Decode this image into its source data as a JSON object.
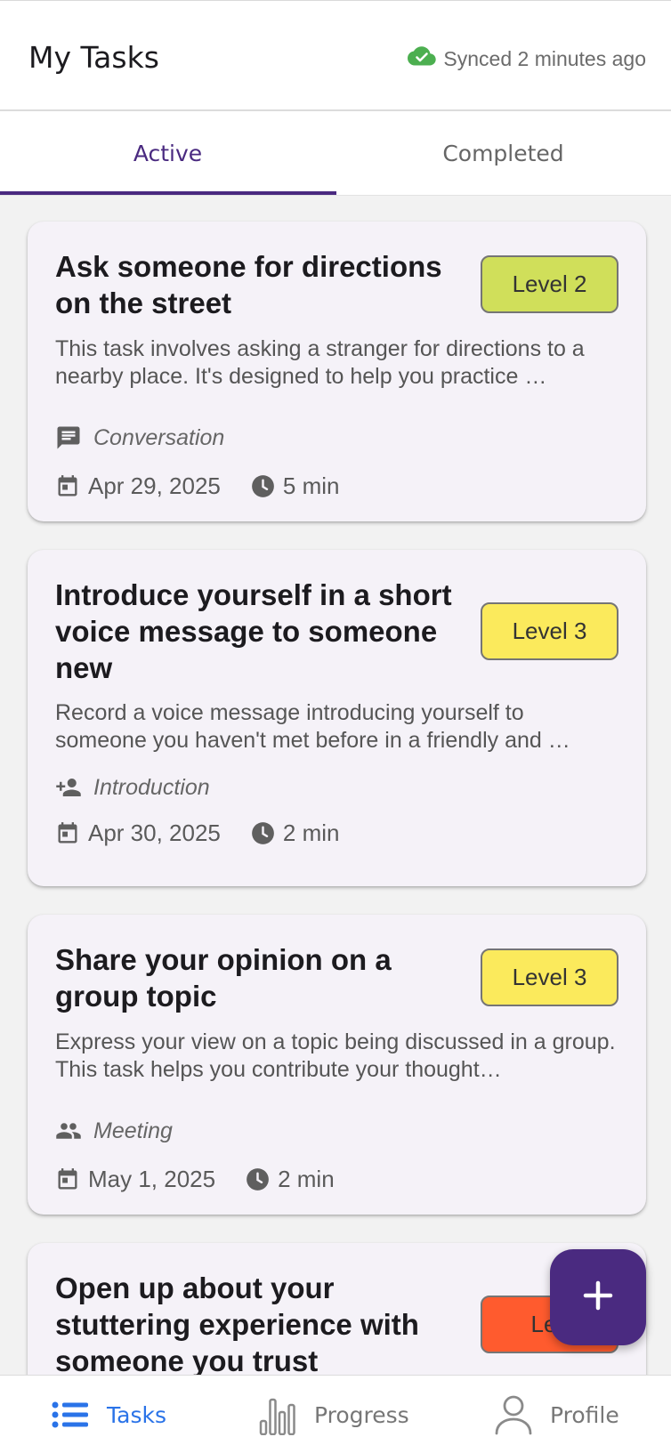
{
  "header": {
    "title": "My Tasks",
    "sync_status": "Synced 2 minutes ago",
    "sync_icon": "cloud-check-icon",
    "sync_color": "#4caf50"
  },
  "tabs": [
    {
      "label": "Active",
      "selected": true
    },
    {
      "label": "Completed",
      "selected": false
    }
  ],
  "tasks": [
    {
      "title": "Ask someone for directions on the street",
      "level": "Level 2",
      "level_color": "#d0df5a",
      "description": "This task involves asking a stranger for directions to a nearby place. It's designed to help you practice …",
      "category": "Conversation",
      "category_icon": "chat-icon",
      "date": "Apr 29, 2025",
      "duration": "5 min"
    },
    {
      "title": "Introduce yourself in a short voice message to someone new",
      "level": "Level 3",
      "level_color": "#fbea5c",
      "description": "Record a voice message introducing yourself to someone you haven't met before in a friendly and …",
      "category": "Introduction",
      "category_icon": "person-add-icon",
      "date": "Apr 30, 2025",
      "duration": "2 min"
    },
    {
      "title": "Share your opinion on a group topic",
      "level": "Level 3",
      "level_color": "#fbea5c",
      "description": "Express your view on a topic being discussed in a group. This task helps you contribute your thought…",
      "category": "Meeting",
      "category_icon": "group-icon",
      "date": "May 1, 2025",
      "duration": "2 min"
    },
    {
      "title": "Open up about your stuttering experience with someone you trust",
      "level": "Lev",
      "level_color": "#ff5b2e"
    }
  ],
  "fab": {
    "icon": "plus-icon",
    "color": "#4a2a80"
  },
  "bottom_nav": [
    {
      "label": "Tasks",
      "icon": "list-icon",
      "selected": true
    },
    {
      "label": "Progress",
      "icon": "bar-chart-icon",
      "selected": false
    },
    {
      "label": "Profile",
      "icon": "person-icon",
      "selected": false
    }
  ],
  "colors": {
    "accent": "#4a2a80",
    "nav_active": "#2a73e8"
  }
}
